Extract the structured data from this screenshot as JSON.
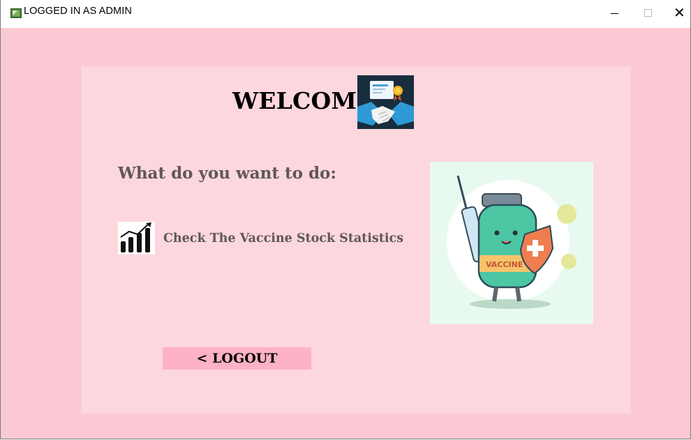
{
  "window": {
    "title": "LOGGED IN AS ADMIN",
    "controls": {
      "minimize": "–",
      "maximize": "□",
      "close": "✕"
    }
  },
  "main": {
    "welcome": "WELCOME",
    "question": "What do you want to do:",
    "stats_option": {
      "label": "Check The Vaccine Stock Statistics",
      "icon": "bar-chart-icon"
    },
    "logout_label": "< LOGOUT"
  },
  "images": {
    "header_icon": "handshake-certificate-icon",
    "illustration": "vaccine-bottle-illustration"
  },
  "colors": {
    "window_bg": "#fbc9d4",
    "panel_bg": "#fdd7de",
    "logout_bg": "#fdb3c5",
    "text_gray": "#5f5758"
  }
}
